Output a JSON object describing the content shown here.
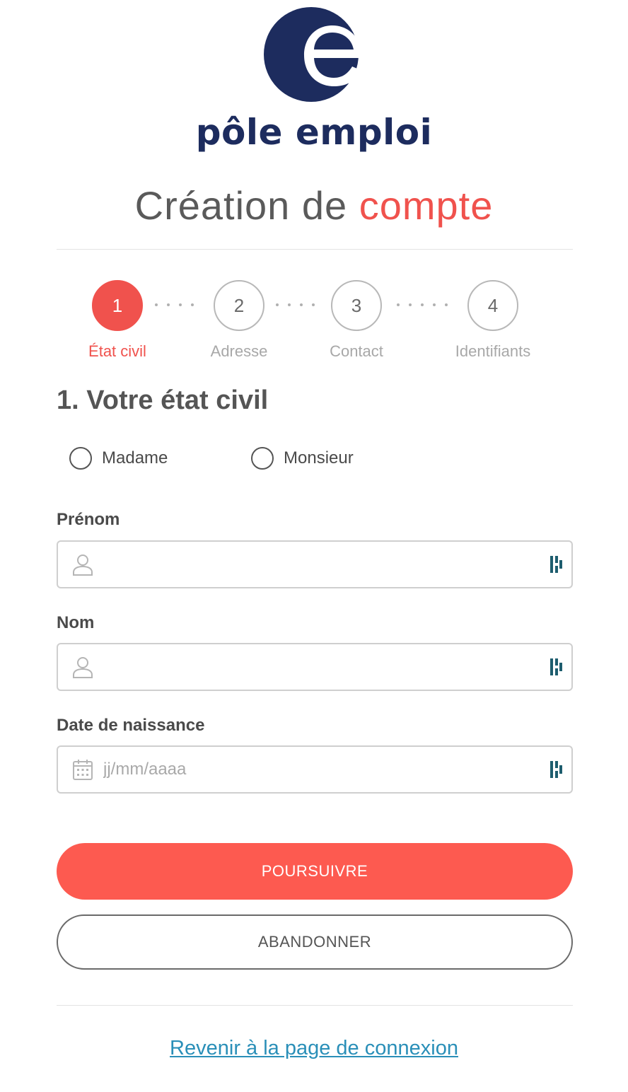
{
  "brand": {
    "name": "pôle emploi",
    "navy": "#1d2c5e",
    "accent": "#f0524d"
  },
  "title": {
    "part1": "Création de",
    "part2": "compte"
  },
  "stepper": {
    "steps": [
      {
        "number": "1",
        "label": "État civil",
        "active": true
      },
      {
        "number": "2",
        "label": "Adresse",
        "active": false
      },
      {
        "number": "3",
        "label": "Contact",
        "active": false
      },
      {
        "number": "4",
        "label": "Identifiants",
        "active": false
      }
    ]
  },
  "section": {
    "title": "1. Votre état civil"
  },
  "civility": {
    "options": [
      "Madame",
      "Monsieur"
    ],
    "selected": null
  },
  "fields": {
    "prenom": {
      "label": "Prénom",
      "value": "",
      "placeholder": "",
      "icon": "user-icon"
    },
    "nom": {
      "label": "Nom",
      "value": "",
      "placeholder": "",
      "icon": "user-icon"
    },
    "naissance": {
      "label": "Date de naissance",
      "value": "",
      "placeholder": "jj/mm/aaaa",
      "icon": "calendar-icon"
    }
  },
  "buttons": {
    "continue": "POURSUIVRE",
    "abandon": "ABANDONNER"
  },
  "links": {
    "back_to_login": "Revenir à la page de connexion"
  }
}
